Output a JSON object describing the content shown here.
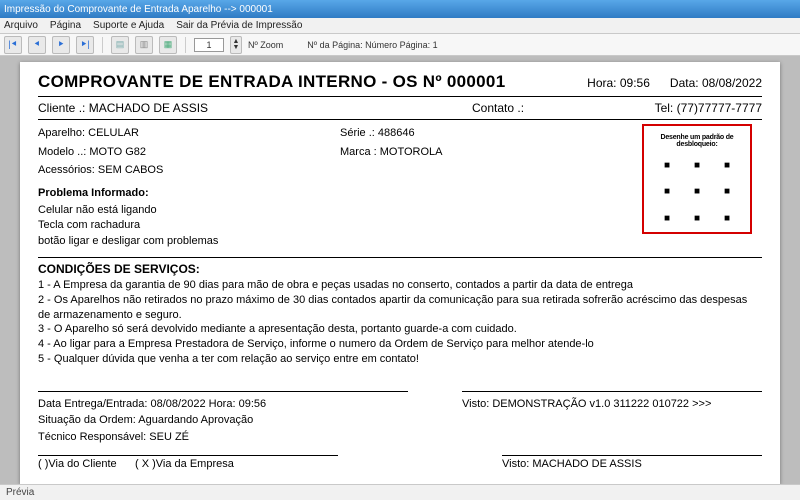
{
  "window": {
    "title": "Impressão do Comprovante de Entrada Aparelho --> 000001"
  },
  "menu": {
    "arquivo": "Arquivo",
    "pagina": "Página",
    "suporte": "Suporte e Ajuda",
    "sair": "Sair da Prévia de Impressão"
  },
  "toolbar": {
    "zoom_value": "1",
    "zoom_label": "Nº Zoom",
    "page_info": "Nº da Página: Número Página: 1"
  },
  "doc": {
    "title": "COMPROVANTE DE ENTRADA INTERNO - OS Nº 000001",
    "hora_label": "Hora:",
    "hora": "09:56",
    "data_label": "Data:",
    "data": "08/08/2022",
    "cliente_label": "Cliente   .:",
    "cliente": "MACHADO DE ASSIS",
    "contato_label": "Contato .:",
    "contato": "",
    "tel_label": "Tel:",
    "tel": "(77)77777-7777",
    "aparelho_label": "Aparelho:",
    "aparelho": "CELULAR",
    "serie_label": "Série  .:",
    "serie": "488646",
    "modelo_label": "Modelo ..:",
    "modelo": "MOTO G82",
    "marca_label": "Marca :",
    "marca": "MOTOROLA",
    "acessorios_label": "Acessórios:",
    "acessorios": "SEM CABOS",
    "pattern_title": "Desenhe um padrão de desbloqueio:",
    "problema_title": "Problema Informado:",
    "problema_l1": "Celular não está ligando",
    "problema_l2": "Tecla com rachadura",
    "problema_l3": "botão ligar e desligar com problemas",
    "cond_title": "CONDIÇÕES DE SERVIÇOS:",
    "cond_1": "1 - A Empresa da garantia de 90 dias para mão de obra e peças usadas no conserto, contados  a partir da data de entrega",
    "cond_2": "2 - Os Aparelhos não retirados no prazo máximo de 30 dias contados apartir da comunicação para sua retirada sofrerão acréscimo das despesas de armazenamento e seguro.",
    "cond_3": "3 - O Aparelho só será devolvido mediante a apresentação desta, portanto guarde-a com cuidado.",
    "cond_4": "4 - Ao ligar para a Empresa Prestadora de Serviço, informe o numero da Ordem de Serviço para melhor atende-lo",
    "cond_5": "5 - Qualquer dúvida que venha a ter com relação ao serviço entre em contato!",
    "entrega_line": "Data Entrega/Entrada: 08/08/2022   Hora:  09:56",
    "situacao_line": "Situação da Ordem: Aguardando Aprovação",
    "tecnico_line": "Técnico Responsável: SEU ZÉ",
    "visto_demo": "Visto: DEMONSTRAÇÃO v1.0 311222 010722 >>>",
    "via_cliente": "(    )Via do Cliente",
    "via_empresa": "( X )Via da Empresa",
    "visto_cliente": "Visto: MACHADO DE ASSIS"
  },
  "status": {
    "previa": "Prévia"
  }
}
